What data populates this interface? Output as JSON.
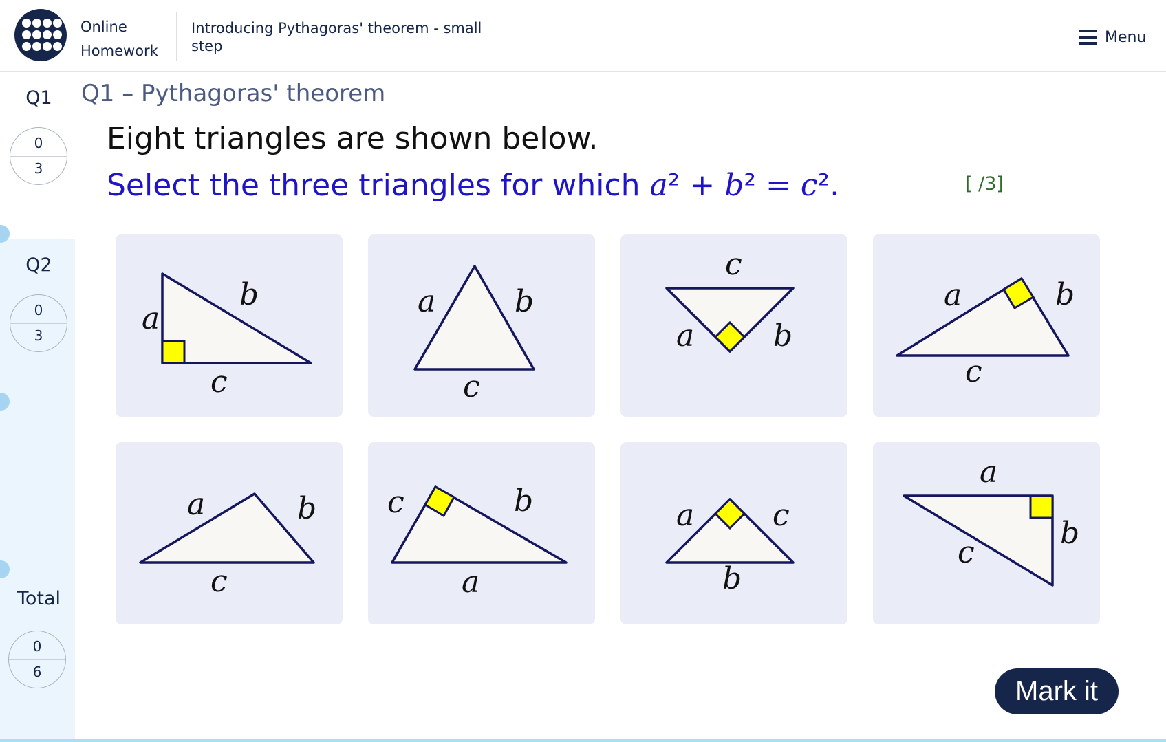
{
  "header": {
    "brand_line1": "Online",
    "brand_line2": "Homework",
    "topic": "Introducing Pythagoras' theorem - small step",
    "menu_label": "Menu"
  },
  "sidebar": {
    "items": [
      {
        "label": "Q1",
        "score": "0",
        "max": "3",
        "active": true
      },
      {
        "label": "Q2",
        "score": "0",
        "max": "3",
        "active": false
      }
    ],
    "total": {
      "label": "Total",
      "score": "0",
      "max": "6"
    }
  },
  "question": {
    "title": "Q1 – Pythagoras' theorem",
    "line1": "Eight triangles are shown below.",
    "line2_text": "Select the three triangles for which ",
    "line2_math_a": "a",
    "line2_math_b": "b",
    "line2_math_c": "c",
    "marks": "[ /3]"
  },
  "triangles": [
    {
      "id": 1,
      "labels": [
        "a",
        "b",
        "c"
      ],
      "right_angle": true
    },
    {
      "id": 2,
      "labels": [
        "a",
        "b",
        "c"
      ],
      "right_angle": false
    },
    {
      "id": 3,
      "labels": [
        "c",
        "a",
        "b"
      ],
      "right_angle": true
    },
    {
      "id": 4,
      "labels": [
        "a",
        "b",
        "c"
      ],
      "right_angle": true
    },
    {
      "id": 5,
      "labels": [
        "a",
        "b",
        "c"
      ],
      "right_angle": false
    },
    {
      "id": 6,
      "labels": [
        "c",
        "b",
        "a"
      ],
      "right_angle": true
    },
    {
      "id": 7,
      "labels": [
        "a",
        "c",
        "b"
      ],
      "right_angle": true
    },
    {
      "id": 8,
      "labels": [
        "a",
        "b",
        "c"
      ],
      "right_angle": true
    }
  ],
  "colors": {
    "navy": "#15264a",
    "prompt_blue": "#1f14c8",
    "card_bg": "#eaedf8",
    "triangle_fill": "#f9f7f3",
    "right_angle_fill": "#ffff00",
    "sidebar_bg": "#eaf5fd"
  },
  "actions": {
    "mark_label": "Mark it"
  }
}
